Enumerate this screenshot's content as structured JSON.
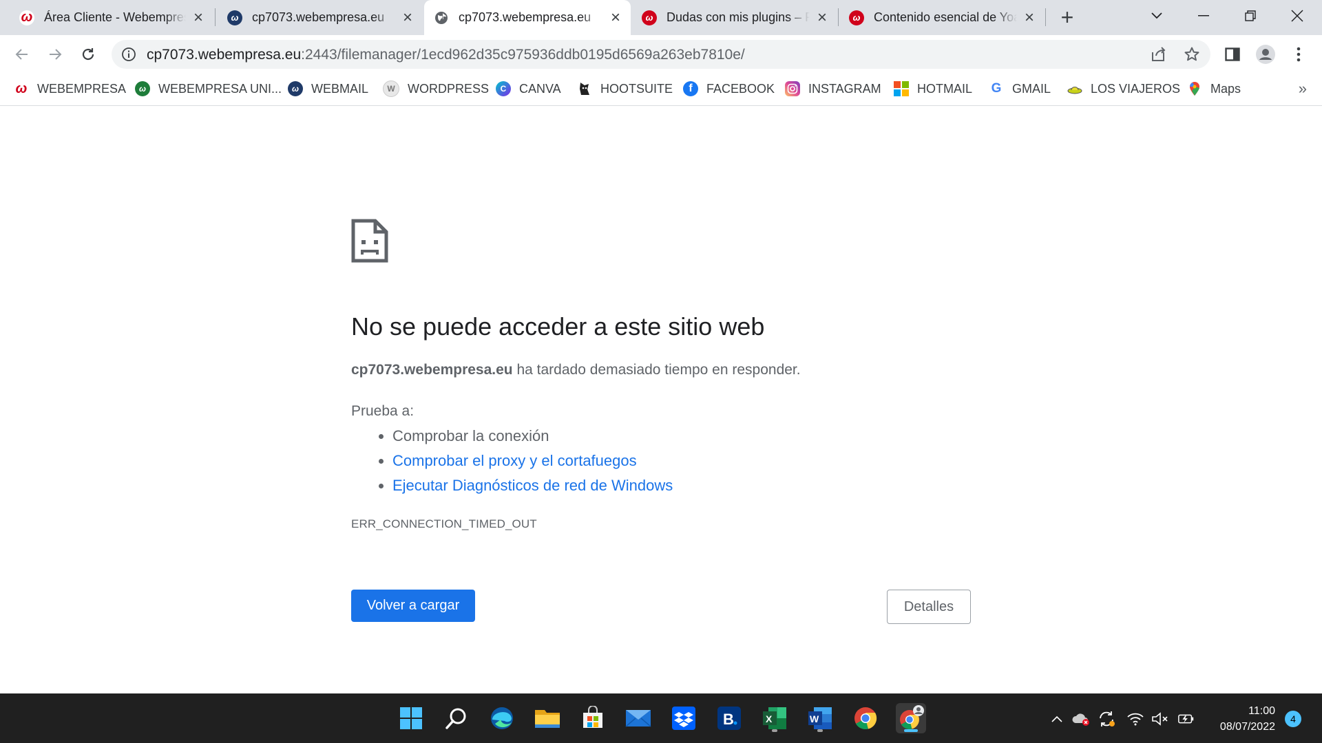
{
  "browser": {
    "tabs": [
      {
        "title": "Área Cliente - Webempresa",
        "favicon": "webempresa-logo-icon",
        "active": false
      },
      {
        "title": "cp7073.webempresa.eu",
        "favicon": "webempresa-w-icon",
        "active": false
      },
      {
        "title": "cp7073.webempresa.eu",
        "favicon": "globe-icon",
        "active": true
      },
      {
        "title": "Dudas con mis plugins – Foro",
        "favicon": "webempresa-red-icon",
        "active": false
      },
      {
        "title": "Contenido esencial de Yoast",
        "favicon": "webempresa-red-icon",
        "active": false
      }
    ],
    "address": {
      "host": "cp7073.webempresa.eu",
      "path": ":2443/filemanager/1ecd962d35c975936ddb0195d6569a263eb7810e/"
    },
    "bookmarks": [
      {
        "label": "WEBEMPRESA",
        "icon": "webempresa-logo-icon"
      },
      {
        "label": "WEBEMPRESA UNI...",
        "icon": "webempresa-w-green-icon"
      },
      {
        "label": "WEBMAIL",
        "icon": "webempresa-w-icon"
      },
      {
        "label": "WORDPRESS",
        "icon": "wordpress-icon"
      },
      {
        "label": "CANVA",
        "icon": "canva-icon"
      },
      {
        "label": "HOOTSUITE",
        "icon": "hootsuite-icon"
      },
      {
        "label": "FACEBOOK",
        "icon": "facebook-icon"
      },
      {
        "label": "INSTAGRAM",
        "icon": "instagram-icon"
      },
      {
        "label": "HOTMAIL",
        "icon": "microsoft-icon"
      },
      {
        "label": "GMAIL",
        "icon": "google-icon"
      },
      {
        "label": "LOS VIAJEROS",
        "icon": "hat-icon"
      },
      {
        "label": "Maps",
        "icon": "maps-pin-icon"
      }
    ]
  },
  "error": {
    "title": "No se puede acceder a este sitio web",
    "host": "cp7073.webempresa.eu",
    "desc_rest": " ha tardado demasiado tiempo en responder.",
    "try_label": "Prueba a:",
    "suggestions": [
      {
        "text": "Comprobar la conexión",
        "link": false
      },
      {
        "text": "Comprobar el proxy y el cortafuegos",
        "link": true
      },
      {
        "text": "Ejecutar Diagnósticos de red de Windows",
        "link": true
      }
    ],
    "code": "ERR_CONNECTION_TIMED_OUT",
    "reload_label": "Volver a cargar",
    "details_label": "Detalles"
  },
  "taskbar": {
    "apps": [
      "windows-start-icon",
      "search-icon",
      "edge-icon",
      "file-explorer-icon",
      "store-icon",
      "mail-icon",
      "dropbox-icon",
      "booking-icon",
      "excel-icon",
      "word-icon",
      "chrome-icon",
      "chrome-profile-icon"
    ],
    "time": "11:00",
    "date": "08/07/2022",
    "notifications": "4"
  },
  "colors": {
    "accent": "#1a73e8",
    "tabstrip": "#dee1e6",
    "taskbar": "#202020"
  }
}
